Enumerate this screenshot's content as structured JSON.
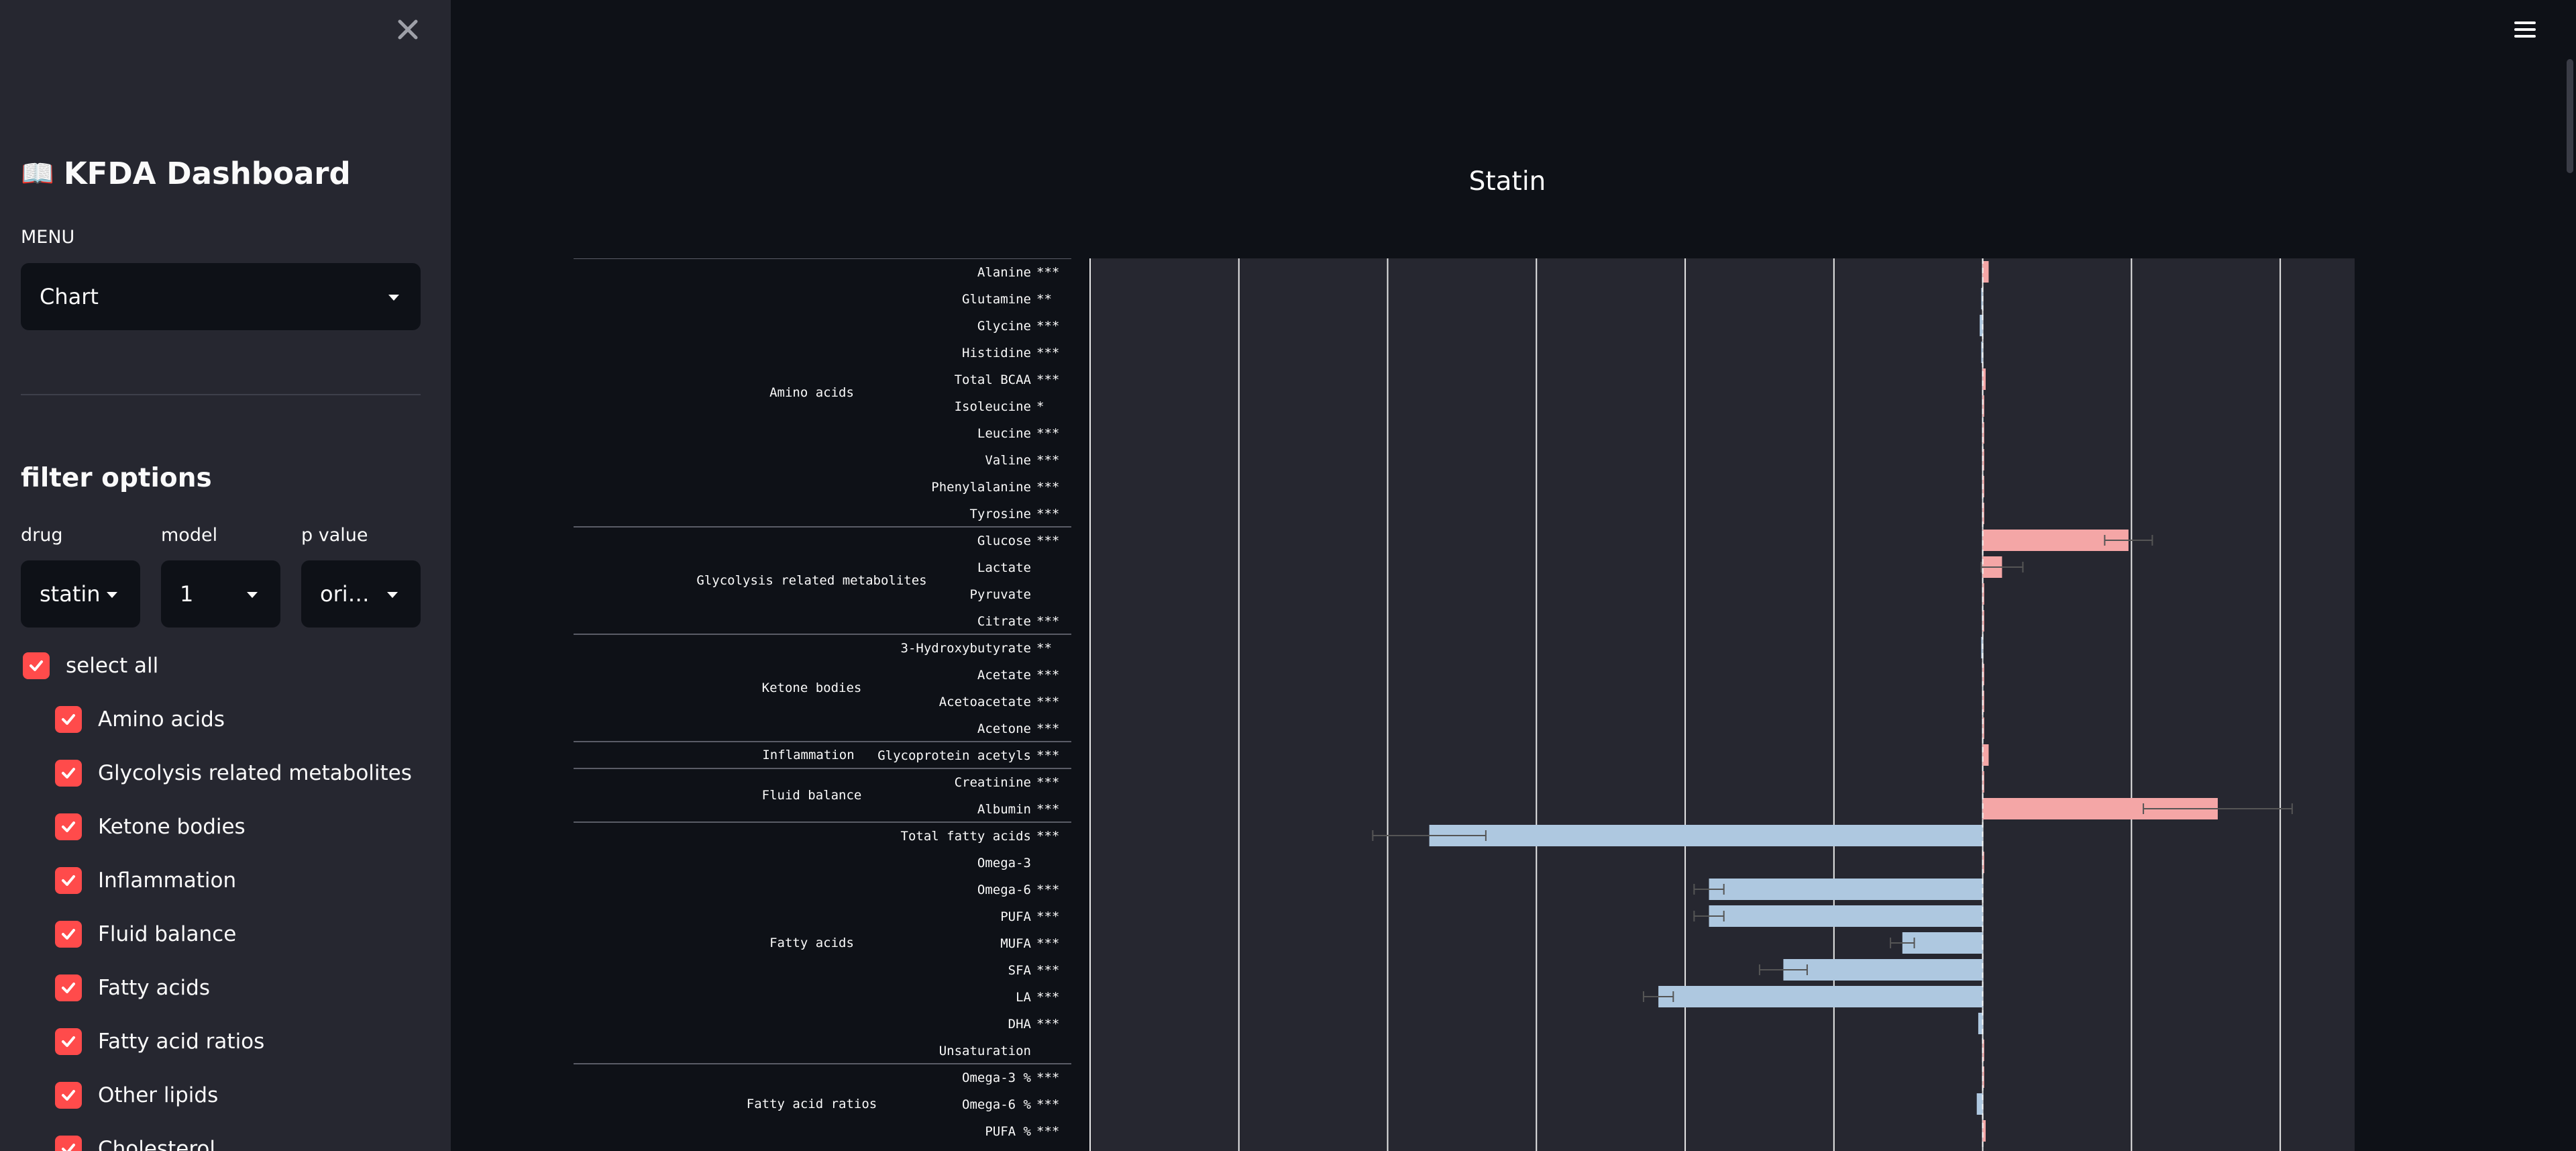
{
  "sidebar": {
    "close_icon": "close-icon",
    "title_icon": "book-icon",
    "title": "KFDA Dashboard",
    "menu_label": "MENU",
    "menu_value": "Chart",
    "filter_title": "filter options",
    "drug_label": "drug",
    "drug_value": "statin",
    "model_label": "model",
    "model_value": "1",
    "pvalue_label": "p value",
    "pvalue_value": "ori…",
    "select_all_label": "select all",
    "categories": [
      "Amino acids",
      "Glycolysis related metabolites",
      "Ketone bodies",
      "Inflammation",
      "Fluid balance",
      "Fatty acids",
      "Fatty acid ratios",
      "Other lipids",
      "Cholesterol"
    ]
  },
  "main": {
    "menu_icon": "hamburger-icon"
  },
  "colors": {
    "positive_bar": "#f4a6a6",
    "negative_bar": "#aec8e0",
    "checkbox": "#ff4b4b",
    "plot_bg": "#262730"
  },
  "chart_data": {
    "type": "bar",
    "title": "Statin",
    "orientation": "horizontal",
    "grid": true,
    "rows": [
      {
        "group": "Amino acids",
        "label": "Alanine",
        "sig": "***",
        "value": 0.02,
        "err": 0.005
      },
      {
        "group": "Amino acids",
        "label": "Glutamine",
        "sig": "**",
        "value": -0.005,
        "err": 0.003
      },
      {
        "group": "Amino acids",
        "label": "Glycine",
        "sig": "***",
        "value": -0.01,
        "err": 0.004
      },
      {
        "group": "Amino acids",
        "label": "Histidine",
        "sig": "***",
        "value": -0.005,
        "err": 0.003
      },
      {
        "group": "Amino acids",
        "label": "Total BCAA",
        "sig": "***",
        "value": 0.01,
        "err": 0.004
      },
      {
        "group": "Amino acids",
        "label": "Isoleucine",
        "sig": "*",
        "value": 0.005,
        "err": 0.003
      },
      {
        "group": "Amino acids",
        "label": "Leucine",
        "sig": "***",
        "value": 0.005,
        "err": 0.003
      },
      {
        "group": "Amino acids",
        "label": "Valine",
        "sig": "***",
        "value": 0.005,
        "err": 0.003
      },
      {
        "group": "Amino acids",
        "label": "Phenylalanine",
        "sig": "***",
        "value": 0.005,
        "err": 0.003
      },
      {
        "group": "Amino acids",
        "label": "Tyrosine",
        "sig": "***",
        "value": 0.005,
        "err": 0.003
      },
      {
        "group": "Glycolysis related metabolites",
        "label": "Glucose",
        "sig": "***",
        "value": 0.49,
        "err": 0.08
      },
      {
        "group": "Glycolysis related metabolites",
        "label": "Lactate",
        "sig": "",
        "value": 0.065,
        "err": 0.07
      },
      {
        "group": "Glycolysis related metabolites",
        "label": "Pyruvate",
        "sig": "",
        "value": 0.005,
        "err": 0.003
      },
      {
        "group": "Glycolysis related metabolites",
        "label": "Citrate",
        "sig": "***",
        "value": 0.005,
        "err": 0.003
      },
      {
        "group": "Ketone bodies",
        "label": "3-Hydroxybutyrate",
        "sig": "**",
        "value": -0.005,
        "err": 0.003
      },
      {
        "group": "Ketone bodies",
        "label": "Acetate",
        "sig": "***",
        "value": 0.005,
        "err": 0.003
      },
      {
        "group": "Ketone bodies",
        "label": "Acetoacetate",
        "sig": "***",
        "value": 0.005,
        "err": 0.003
      },
      {
        "group": "Ketone bodies",
        "label": "Acetone",
        "sig": "***",
        "value": 0.005,
        "err": 0.003
      },
      {
        "group": "Inflammation",
        "label": "Glycoprotein acetyls",
        "sig": "***",
        "value": 0.02,
        "err": 0.005
      },
      {
        "group": "Fluid balance",
        "label": "Creatinine",
        "sig": "***",
        "value": 0.005,
        "err": 0.003
      },
      {
        "group": "Fluid balance",
        "label": "Albumin",
        "sig": "***",
        "value": 0.79,
        "err": 0.25
      },
      {
        "group": "Fatty acids",
        "label": "Total fatty acids",
        "sig": "***",
        "value": -1.86,
        "err": 0.19
      },
      {
        "group": "Fatty acids",
        "label": "Omega-3",
        "sig": "",
        "value": 0.005,
        "err": 0.003
      },
      {
        "group": "Fatty acids",
        "label": "Omega-6",
        "sig": "***",
        "value": -0.92,
        "err": 0.05
      },
      {
        "group": "Fatty acids",
        "label": "PUFA",
        "sig": "***",
        "value": -0.92,
        "err": 0.05
      },
      {
        "group": "Fatty acids",
        "label": "MUFA",
        "sig": "***",
        "value": -0.27,
        "err": 0.04
      },
      {
        "group": "Fatty acids",
        "label": "SFA",
        "sig": "***",
        "value": -0.67,
        "err": 0.08
      },
      {
        "group": "Fatty acids",
        "label": "LA",
        "sig": "***",
        "value": -1.09,
        "err": 0.05
      },
      {
        "group": "Fatty acids",
        "label": "DHA",
        "sig": "***",
        "value": -0.015,
        "err": 0.005
      },
      {
        "group": "Fatty acids",
        "label": "Unsaturation",
        "sig": "",
        "value": 0.005,
        "err": 0.003
      },
      {
        "group": "Fatty acid ratios",
        "label": "Omega-3 %",
        "sig": "***",
        "value": 0.005,
        "err": 0.003
      },
      {
        "group": "Fatty acid ratios",
        "label": "Omega-6 %",
        "sig": "***",
        "value": -0.02,
        "err": 0.005
      },
      {
        "group": "Fatty acid ratios",
        "label": "PUFA %",
        "sig": "***",
        "value": 0.01,
        "err": 0.004
      }
    ],
    "xlim": [
      -3.0,
      1.25
    ],
    "grid_x": [
      -3.0,
      -2.5,
      -2.0,
      -1.5,
      -1.0,
      -0.5,
      0.0,
      0.5,
      1.0
    ]
  }
}
